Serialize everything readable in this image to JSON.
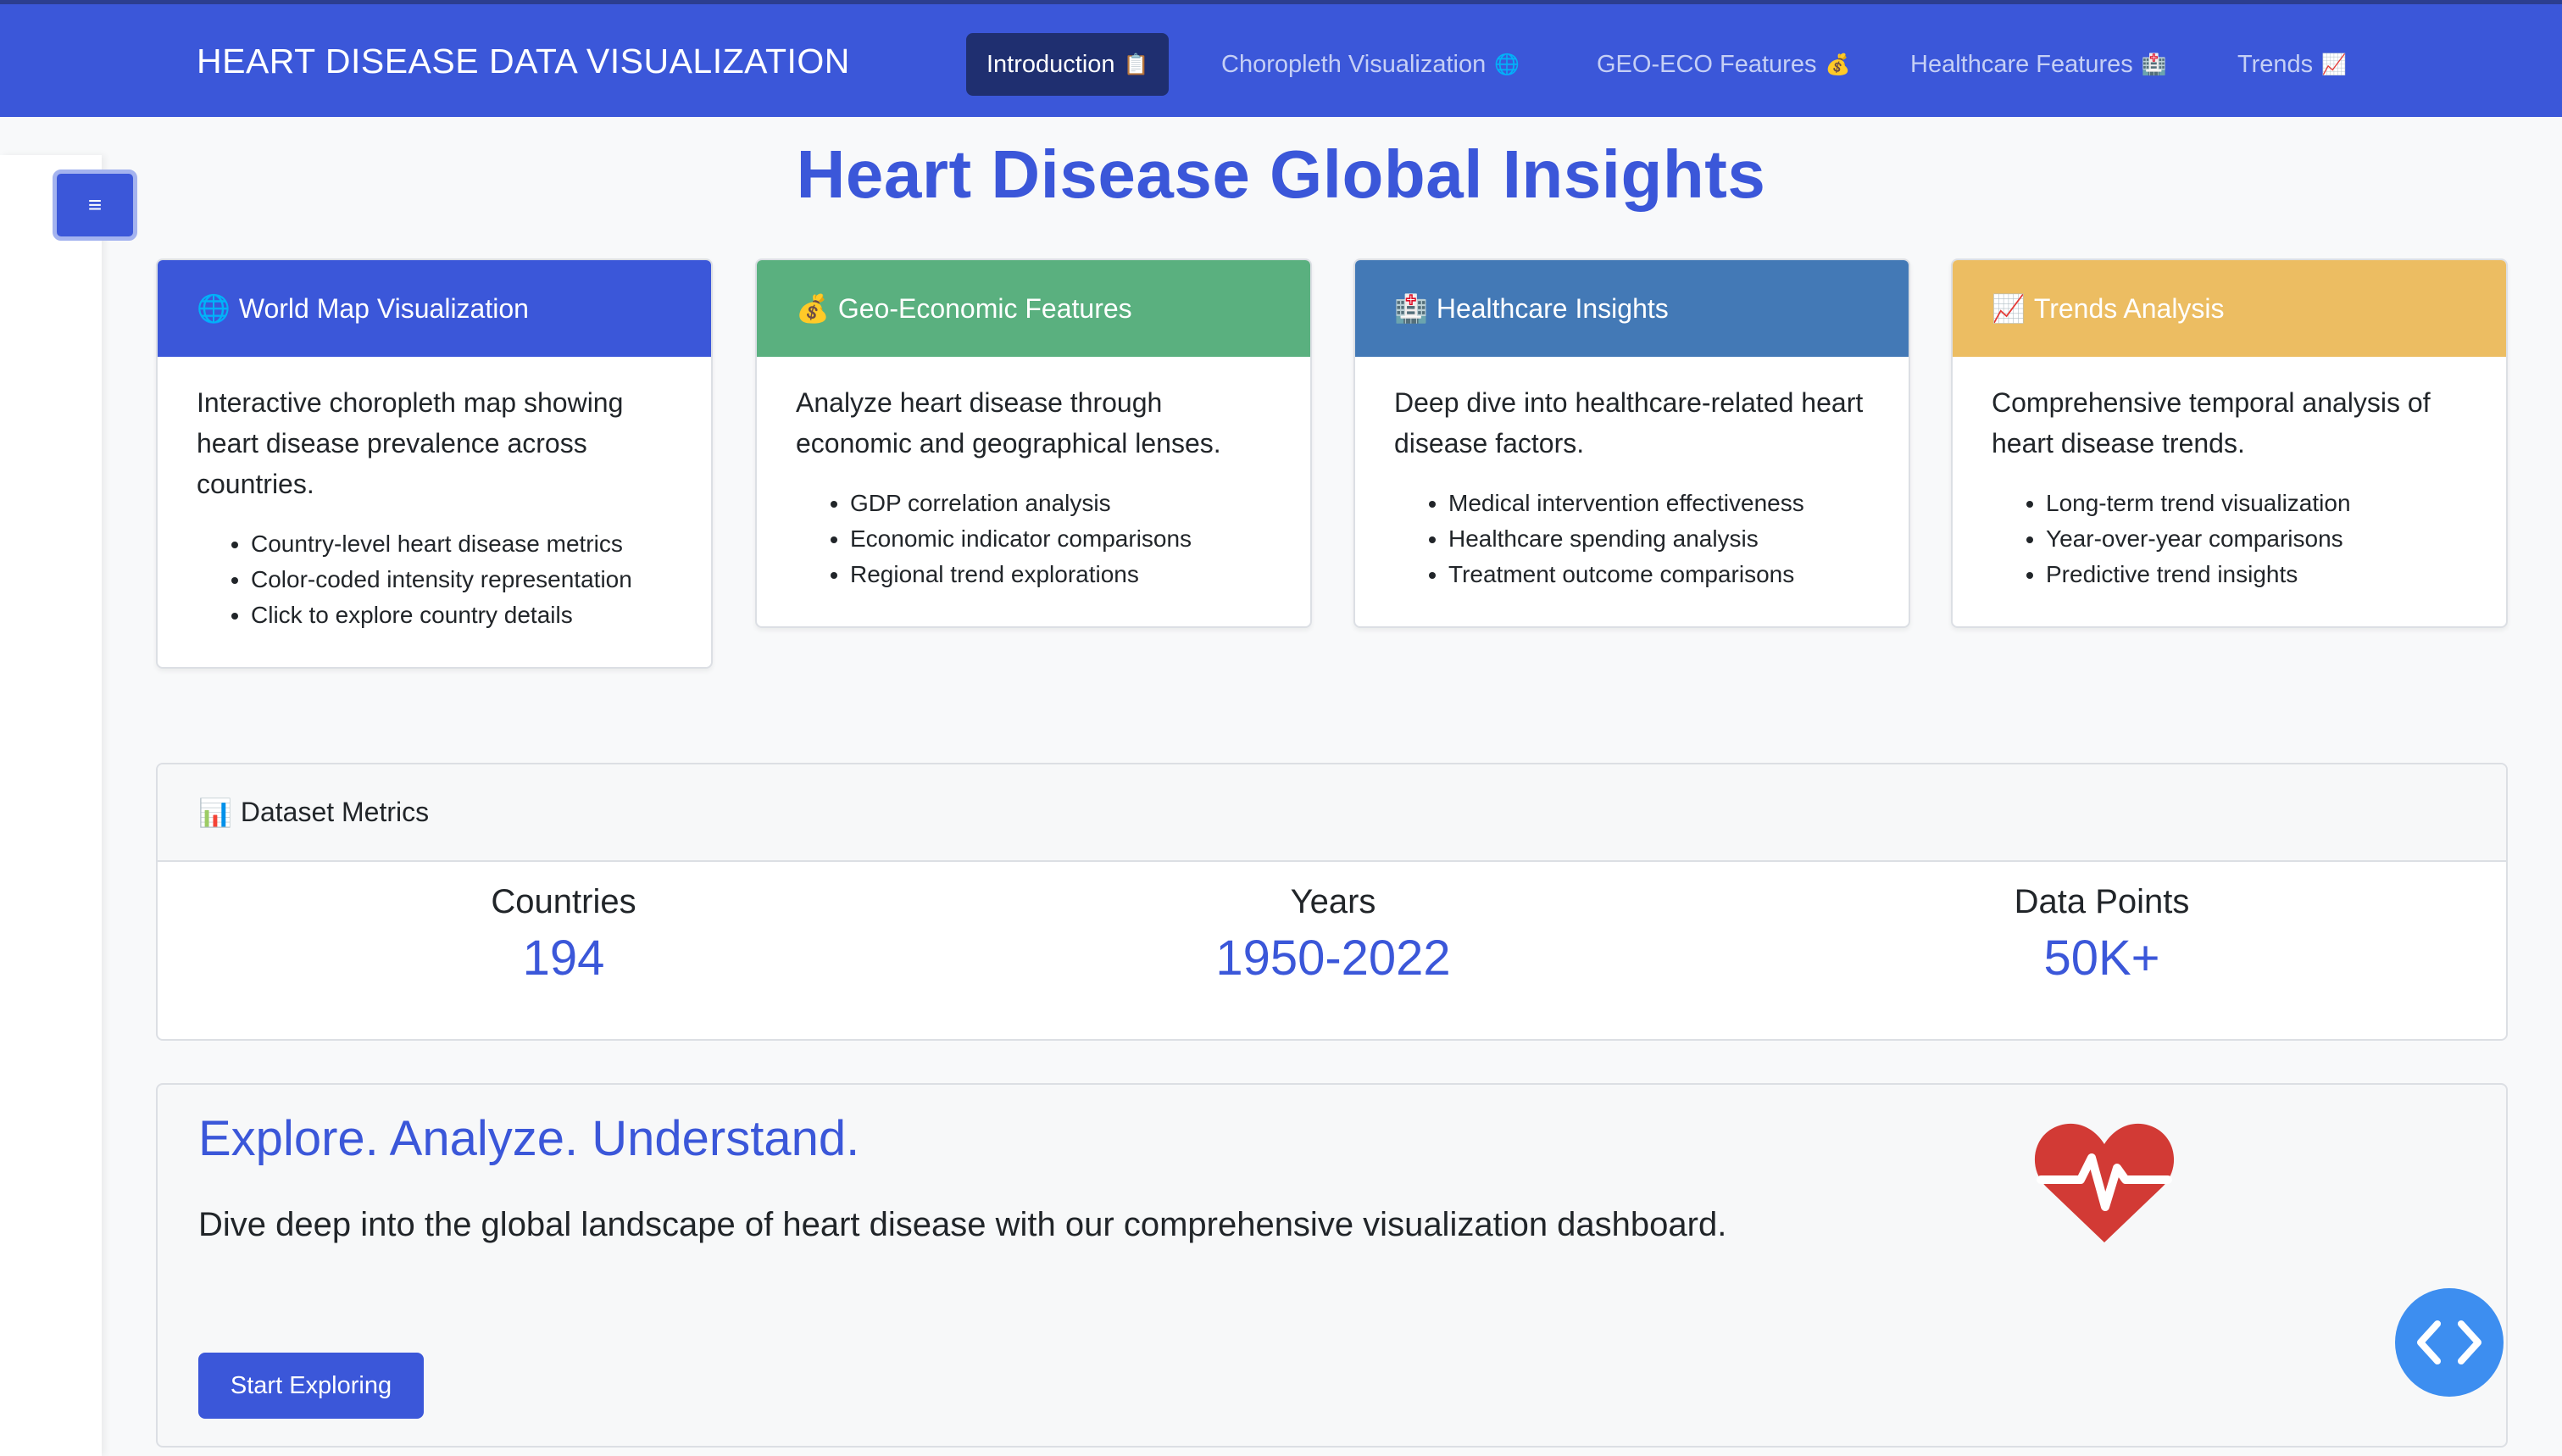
{
  "navbar": {
    "brand": "HEART DISEASE DATA VISUALIZATION",
    "items": [
      {
        "label": "Introduction",
        "emoji": "📋",
        "active": true
      },
      {
        "label": "Choropleth Visualization",
        "emoji": "🌐",
        "active": false
      },
      {
        "label": "GEO-ECO Features",
        "emoji": "💰",
        "active": false
      },
      {
        "label": "Healthcare Features",
        "emoji": "🏥",
        "active": false
      },
      {
        "label": "Trends",
        "emoji": "📈",
        "active": false
      }
    ]
  },
  "sidebar": {
    "toggle_label": "≡"
  },
  "page": {
    "title": "Heart Disease Global Insights"
  },
  "cards": [
    {
      "emoji": "🌐",
      "title": "World Map Visualization",
      "color": "#3b57d9",
      "description": "Interactive choropleth map showing heart disease prevalence across countries.",
      "bullets": [
        "Country-level heart disease metrics",
        "Color-coded intensity representation",
        "Click to explore country details"
      ]
    },
    {
      "emoji": "💰",
      "title": "Geo-Economic Features",
      "color": "#5ab07f",
      "description": "Analyze heart disease through economic and geographical lenses.",
      "bullets": [
        "GDP correlation analysis",
        "Economic indicator comparisons",
        "Regional trend explorations"
      ]
    },
    {
      "emoji": "🏥",
      "title": "Healthcare Insights",
      "color": "#4379b6",
      "description": "Deep dive into healthcare-related heart disease factors.",
      "bullets": [
        "Medical intervention effectiveness",
        "Healthcare spending analysis",
        "Treatment outcome comparisons"
      ]
    },
    {
      "emoji": "📈",
      "title": "Trends Analysis",
      "color": "#ecbd62",
      "description": "Comprehensive temporal analysis of heart disease trends.",
      "bullets": [
        "Long-term trend visualization",
        "Year-over-year comparisons",
        "Predictive trend insights"
      ]
    }
  ],
  "metrics": {
    "emoji": "📊",
    "title": "Dataset Metrics",
    "items": [
      {
        "label": "Countries",
        "value": "194"
      },
      {
        "label": "Years",
        "value": "1950-2022"
      },
      {
        "label": "Data Points",
        "value": "50K+"
      }
    ]
  },
  "hero": {
    "title": "Explore. Analyze. Understand.",
    "text": "Dive deep into the global landscape of heart disease with our comprehensive visualization dashboard.",
    "button": "Start Exploring",
    "icon": "heart-pulse-icon",
    "icon_color": "#d23a35"
  },
  "fab": {
    "icon": "code-icon",
    "color": "#3d8ef0"
  }
}
